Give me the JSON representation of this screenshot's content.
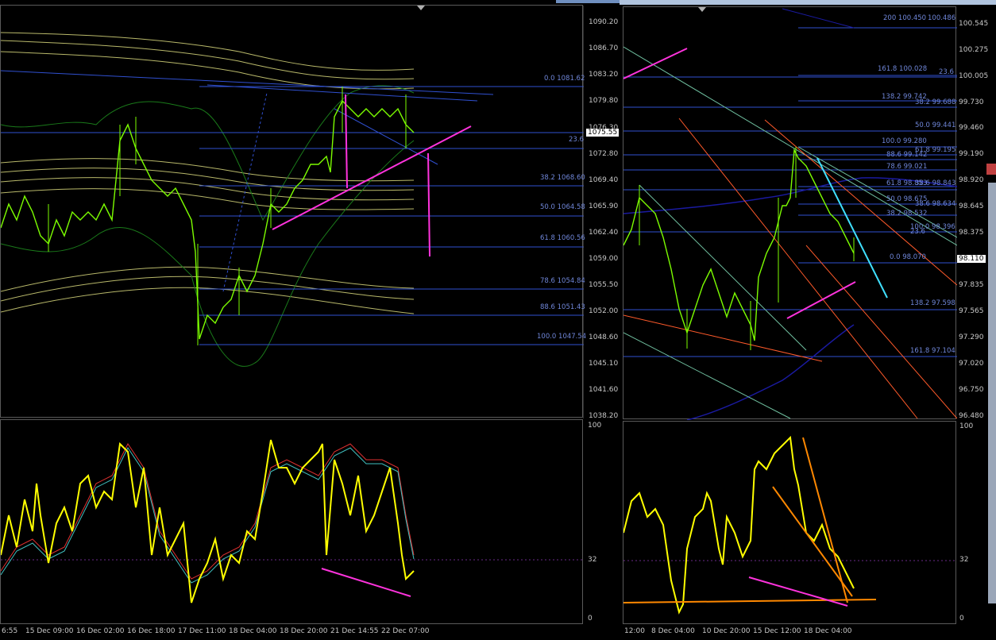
{
  "left": {
    "price_axis": [
      "1090.20",
      "1086.70",
      "1083.20",
      "1079.80",
      "1076.30",
      "1072.80",
      "1069.40",
      "1065.90",
      "1062.40",
      "1059.00",
      "1055.50",
      "1052.00",
      "1048.60",
      "1045.10",
      "1041.60",
      "1038.20"
    ],
    "current_price": "1075.55",
    "fib_levels": [
      "0.0 1081.62",
      "23.6",
      "38.2 1068.60",
      "50.0 1064.58",
      "61.8 1060.56",
      "78.6 1054.84",
      "88.6 1051.43",
      "100.0 1047.54"
    ],
    "osc_axis": [
      "100",
      "32",
      "0"
    ],
    "time_axis": [
      "6:55",
      "15 Dec 09:00",
      "16 Dec 02:00",
      "16 Dec 18:00",
      "17 Dec 11:00",
      "18 Dec 04:00",
      "18 Dec 20:00",
      "21 Dec 14:55",
      "22 Dec 07:00"
    ]
  },
  "right": {
    "price_axis": [
      "100.545",
      "100.275",
      "100.005",
      "99.730",
      "99.460",
      "99.190",
      "98.920",
      "98.645",
      "98.375",
      "98.110",
      "97.835",
      "97.565",
      "97.290",
      "97.020",
      "96.750",
      "96.480"
    ],
    "current_price": "98.110",
    "fib_levels": [
      "200 100.450",
      "100.486",
      "161.8 100.028",
      "23.6",
      "138.2 99.742",
      "38.2 99.688",
      "50.0 99.441",
      "100.0 99.280",
      "61.8 99.195",
      "88.6 99.142",
      "78.6 99.021",
      "61.8 98.853",
      "38.6 98.843",
      "50.0 98.675",
      "38.6 98.634",
      "38.2 98.532",
      "100.0 98.396",
      "23.6",
      "0.0 98.070",
      "138.2 97.598",
      "161.8 97.104"
    ],
    "osc_axis": [
      "100",
      "32",
      "0"
    ],
    "time_axis": [
      "12:00",
      "8 Dec 04:00",
      "10 Dec 20:00",
      "15 Dec 12:00",
      "18 Dec 04:00"
    ]
  },
  "colors": {
    "candle": "#7cfc00",
    "envelope": "#b8b86a",
    "bollinger": "#1a7a1a",
    "fib": "#3050d0",
    "magenta": "#ff33dd",
    "stoch_main": "#ffff00",
    "stoch_signal1": "#e03030",
    "stoch_signal2": "#40c0c0",
    "orange": "#ff8800",
    "cyan": "#40e0ff",
    "downtrend": "#ff5a2a"
  }
}
